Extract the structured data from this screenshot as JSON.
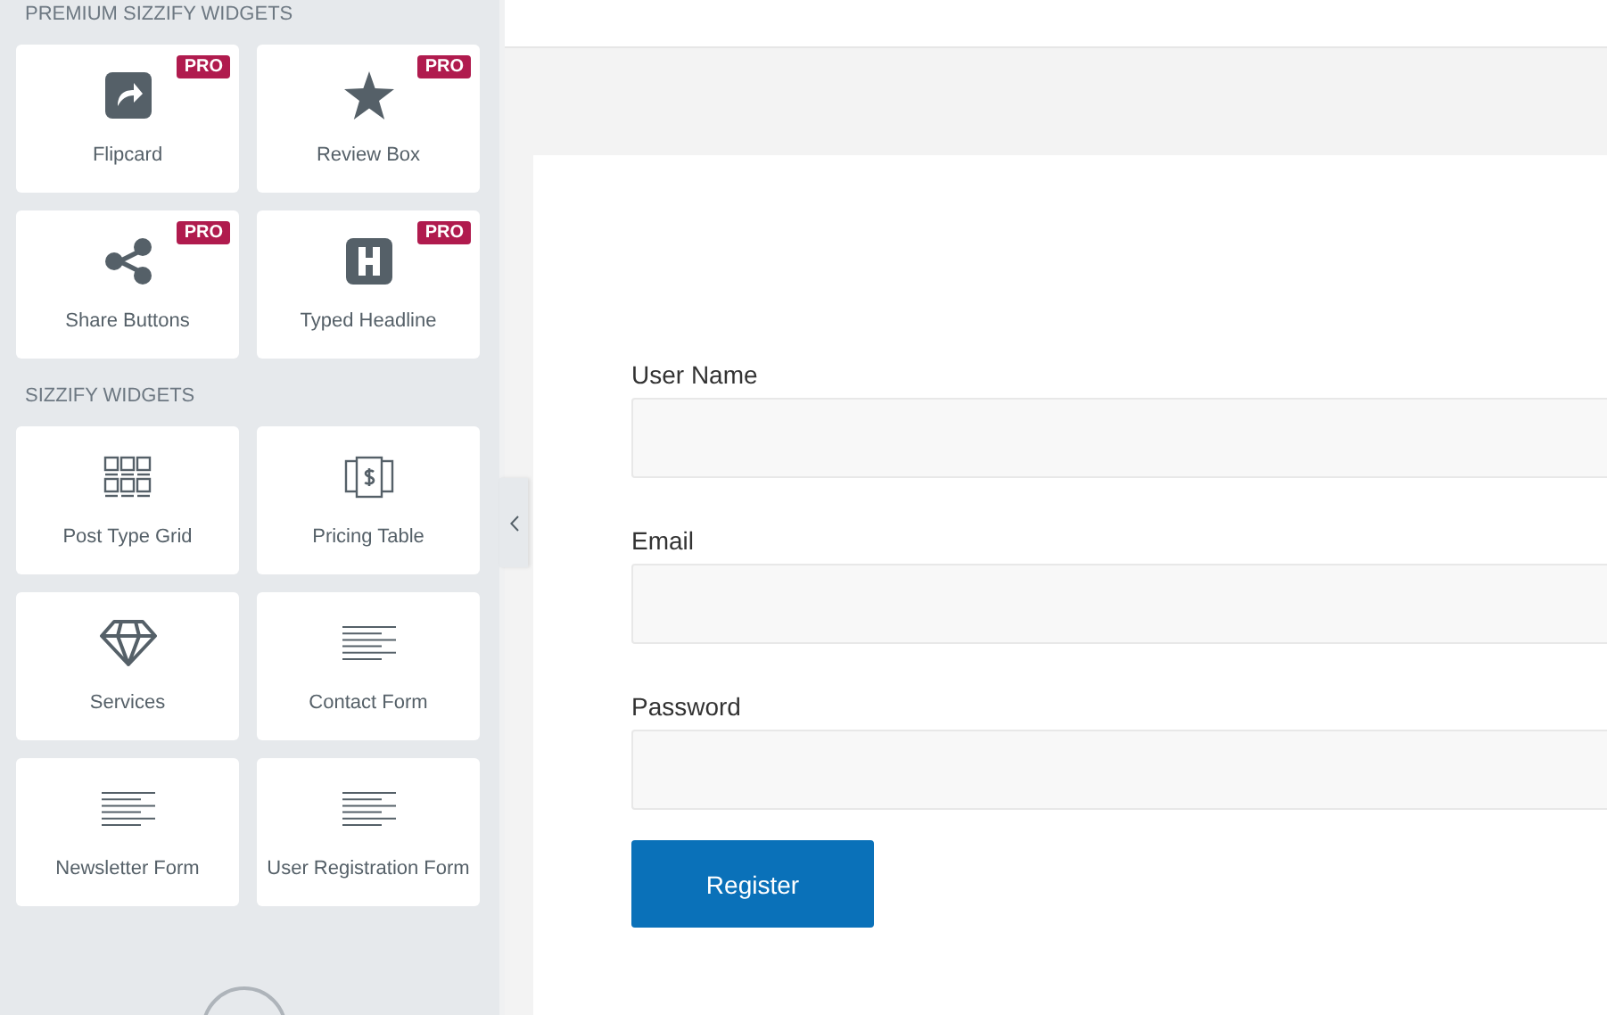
{
  "sidebar": {
    "sections": [
      {
        "title": "PREMIUM SIZZIFY WIDGETS",
        "widgets": [
          {
            "label": "Flipcard",
            "kind": "flipcard",
            "pro": true,
            "badge": "PRO"
          },
          {
            "label": "Review Box",
            "kind": "star",
            "pro": true,
            "badge": "PRO"
          },
          {
            "label": "Share Buttons",
            "kind": "share",
            "pro": true,
            "badge": "PRO"
          },
          {
            "label": "Typed Headline",
            "kind": "heading",
            "pro": true,
            "badge": "PRO"
          }
        ]
      },
      {
        "title": "SIZZIFY WIDGETS",
        "widgets": [
          {
            "label": "Post Type Grid",
            "kind": "grid",
            "pro": false
          },
          {
            "label": "Pricing Table",
            "kind": "pricing",
            "pro": false
          },
          {
            "label": "Services",
            "kind": "diamond",
            "pro": false
          },
          {
            "label": "Contact Form",
            "kind": "lines",
            "pro": false
          },
          {
            "label": "Newsletter Form",
            "kind": "lines",
            "pro": false
          },
          {
            "label": "User Registration Form",
            "kind": "lines",
            "pro": false
          }
        ]
      }
    ]
  },
  "form": {
    "fields": [
      {
        "label": "User Name"
      },
      {
        "label": "Email"
      },
      {
        "label": "Password"
      }
    ],
    "submit": "Register"
  }
}
